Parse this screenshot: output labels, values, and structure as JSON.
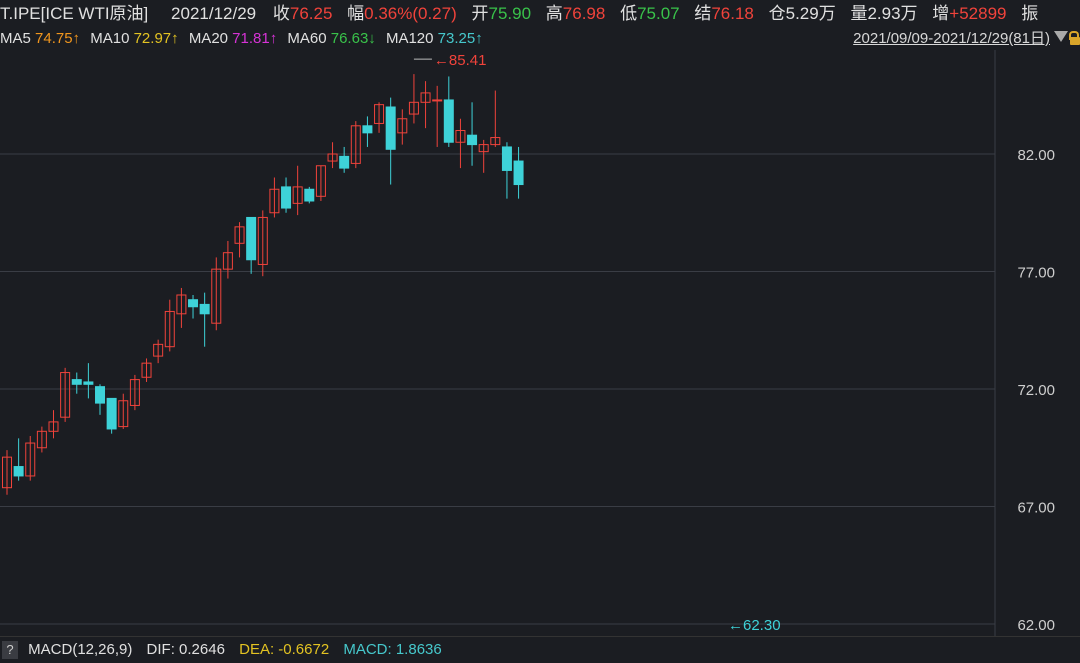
{
  "header": {
    "symbol": "T.IPE[ICE WTI原油]",
    "date": "2021/12/29",
    "close_label": "收",
    "close_value": "76.25",
    "change_label": "幅",
    "change_value": "0.36%(0.27)",
    "open_label": "开",
    "open_value": "75.90",
    "high_label": "高",
    "high_value": "76.98",
    "low_label": "低",
    "low_value": "75.07",
    "settle_label": "结",
    "settle_value": "76.18",
    "oi_label": "仓",
    "oi_value": "5.29万",
    "vol_label": "量",
    "vol_value": "2.93万",
    "inc_label": "增",
    "inc_value": "+52899",
    "amp_label": "振"
  },
  "ma_legend": {
    "ma5_label": "MA5",
    "ma5_value": "74.75↑",
    "ma10_label": "MA10",
    "ma10_value": "72.97↑",
    "ma20_label": "MA20",
    "ma20_value": "71.81↑",
    "ma60_label": "MA60",
    "ma60_value": "76.63↓",
    "ma120_label": "MA120",
    "ma120_value": "73.25↑",
    "date_range": "2021/09/09-2021/12/29(81日)"
  },
  "footer": {
    "help": "?",
    "macd_label": "MACD(12,26,9)",
    "dif": "DIF: 0.2646",
    "dea": "DEA: -0.6672",
    "macd": "MACD: 1.8636"
  },
  "colors": {
    "up": "#f0433b",
    "down": "#3ed2d8",
    "ma5": "#ffffff",
    "ma10": "#e3c322",
    "ma20": "#d633d6",
    "ma60": "#2fb14a",
    "ma120": "#46c8cc",
    "grid": "#3a3d45",
    "axis_text": "#cfcfcf"
  },
  "chart_data": {
    "type": "candlestick",
    "ylim": [
      62,
      86
    ],
    "yticks": [
      "82.00",
      "77.00",
      "72.00",
      "67.00",
      "62.00"
    ],
    "high_marker": "85.41",
    "low_marker": "62.30",
    "candles": [
      [
        67.8,
        69.1,
        67.5,
        69.4
      ],
      [
        68.7,
        68.3,
        68.1,
        69.9
      ],
      [
        68.3,
        69.7,
        68.1,
        70.0
      ],
      [
        69.5,
        70.2,
        69.3,
        70.4
      ],
      [
        70.2,
        70.6,
        69.9,
        71.1
      ],
      [
        70.8,
        72.7,
        70.6,
        72.9
      ],
      [
        72.4,
        72.2,
        71.8,
        72.7
      ],
      [
        72.3,
        72.2,
        71.6,
        73.1
      ],
      [
        72.1,
        71.4,
        70.9,
        72.2
      ],
      [
        71.6,
        70.3,
        70.1,
        71.6
      ],
      [
        70.4,
        71.5,
        70.3,
        71.8
      ],
      [
        71.3,
        72.4,
        71.1,
        72.6
      ],
      [
        72.5,
        73.1,
        72.3,
        73.3
      ],
      [
        73.4,
        73.9,
        73.1,
        74.1
      ],
      [
        73.8,
        75.3,
        73.6,
        75.8
      ],
      [
        75.2,
        76.0,
        74.6,
        76.3
      ],
      [
        75.8,
        75.5,
        75.0,
        76.0
      ],
      [
        75.6,
        75.2,
        73.8,
        76.1
      ],
      [
        74.8,
        77.1,
        74.5,
        77.6
      ],
      [
        77.1,
        77.8,
        76.7,
        78.3
      ],
      [
        78.2,
        78.9,
        77.6,
        79.1
      ],
      [
        79.3,
        77.5,
        76.9,
        79.2
      ],
      [
        77.3,
        79.3,
        76.8,
        79.6
      ],
      [
        79.5,
        80.5,
        79.3,
        81.0
      ],
      [
        80.6,
        79.7,
        79.5,
        81.0
      ],
      [
        79.9,
        80.6,
        79.4,
        81.5
      ],
      [
        80.5,
        80.0,
        79.9,
        80.6
      ],
      [
        80.2,
        81.5,
        80.0,
        81.5
      ],
      [
        81.7,
        82.0,
        81.4,
        82.5
      ],
      [
        81.9,
        81.4,
        81.2,
        82.3
      ],
      [
        81.6,
        83.2,
        81.4,
        83.4
      ],
      [
        83.2,
        82.9,
        82.3,
        83.6
      ],
      [
        83.3,
        84.1,
        82.9,
        84.2
      ],
      [
        84.0,
        82.2,
        80.7,
        84.4
      ],
      [
        82.9,
        83.5,
        82.4,
        83.9
      ],
      [
        83.7,
        84.2,
        83.3,
        85.4
      ],
      [
        84.2,
        84.6,
        83.1,
        85.1
      ],
      [
        84.3,
        84.3,
        82.3,
        84.9
      ],
      [
        84.3,
        82.5,
        82.3,
        85.3
      ],
      [
        82.5,
        83.0,
        81.4,
        83.5
      ],
      [
        82.8,
        82.4,
        81.5,
        84.2
      ],
      [
        82.1,
        82.4,
        81.2,
        82.6
      ],
      [
        82.4,
        82.7,
        82.3,
        84.7
      ],
      [
        82.3,
        81.3,
        80.1,
        82.5
      ],
      [
        81.7,
        80.7,
        80.1,
        82.3
      ]
    ]
  }
}
